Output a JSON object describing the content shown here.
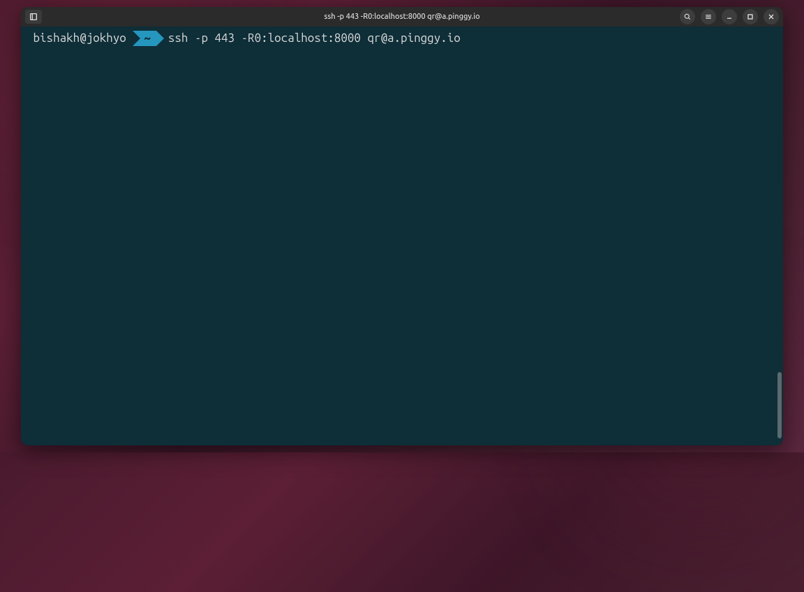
{
  "titlebar": {
    "title": "ssh -p 443 -R0:localhost:8000 qr@a.pinggy.io"
  },
  "prompt": {
    "user_host": " bishakh@jokhyo ",
    "path": "~",
    "command": "ssh -p 443 -R0:localhost:8000 qr@a.pinggy.io"
  }
}
